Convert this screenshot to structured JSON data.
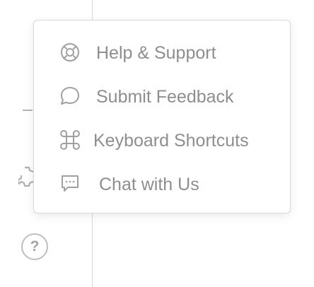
{
  "rail": {
    "help_glyph": "?"
  },
  "menu": {
    "items": [
      {
        "label": "Help & Support",
        "icon": "lifebuoy-icon"
      },
      {
        "label": "Submit Feedback",
        "icon": "speech-bubble-icon"
      },
      {
        "label": "Keyboard Shortcuts",
        "icon": "command-key-icon"
      },
      {
        "label": "Chat with Us",
        "icon": "chat-dots-icon"
      }
    ]
  },
  "colors": {
    "text": "#8e8e8e",
    "icon": "#a0a0a0",
    "border": "#d7d7d7",
    "background": "#ffffff"
  }
}
